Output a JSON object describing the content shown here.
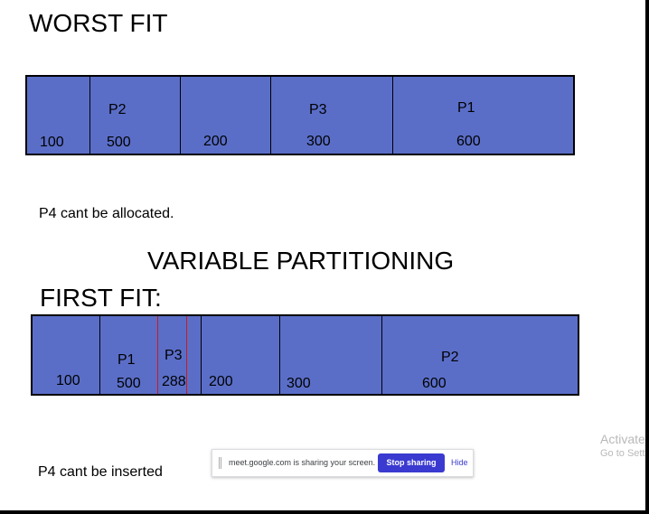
{
  "worst_fit": {
    "title": "WORST FIT",
    "blocks": [
      {
        "size": "100",
        "process": ""
      },
      {
        "size": "500",
        "process": "P2"
      },
      {
        "size": "200",
        "process": ""
      },
      {
        "size": "300",
        "process": "P3"
      },
      {
        "size": "600",
        "process": "P1"
      }
    ],
    "note": "P4 cant be allocated."
  },
  "section_title": "VARIABLE PARTITIONING",
  "first_fit": {
    "title": "FIRST FIT:",
    "blocks": [
      {
        "size": "100",
        "process": ""
      },
      {
        "size": "500",
        "process": "P1"
      },
      {
        "size": "288",
        "process": "P3"
      },
      {
        "size": "200",
        "process": ""
      },
      {
        "size": "300",
        "process": ""
      },
      {
        "size": "600",
        "process": "P2"
      }
    ],
    "note": "P4 cant be inserted"
  },
  "windows_watermark": {
    "line1": "Activate",
    "line2": "Go to Setti"
  },
  "screen_share_bar": {
    "message": "meet.google.com is sharing your screen.",
    "stop_label": "Stop sharing",
    "hide_label": "Hide"
  },
  "colors": {
    "partition_fill": "#5a6ec8",
    "allocation_marker": "#d01818",
    "stop_button": "#3a3ad0"
  }
}
